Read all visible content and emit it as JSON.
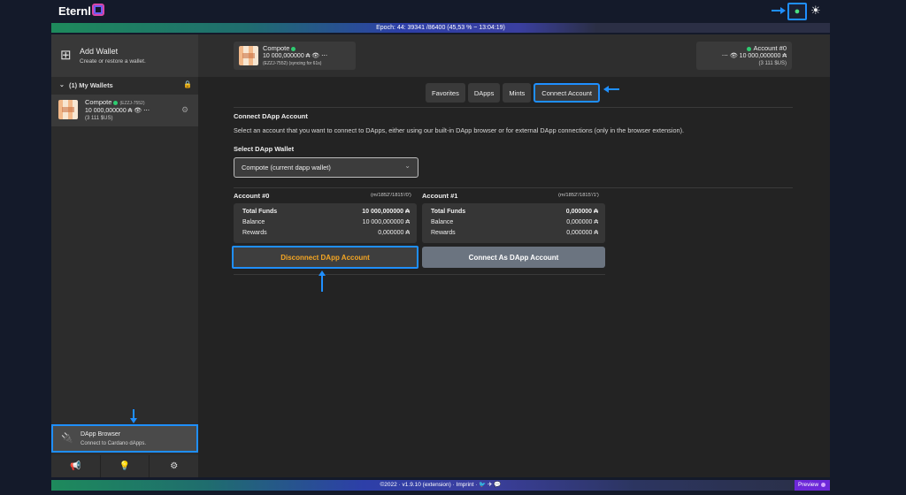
{
  "header": {
    "app_name": "Eternl",
    "dapp_toggle_icon": "plug-globe-icon",
    "theme_icon": "sun-icon"
  },
  "epoch": {
    "text": "Epoch: 44: 39341 /86400 (45,53 % ~ 13:04:19)"
  },
  "sidebar": {
    "add_wallet_title": "Add Wallet",
    "add_wallet_subtitle": "Create or restore a wallet.",
    "group_label": "(1) My Wallets",
    "wallet": {
      "name": "Compote",
      "tag": "(EZZJ-7552)",
      "balance": "10 000,000000 ₳",
      "usd": "(3 111 $US)"
    },
    "dapp_browser_title": "DApp Browser",
    "dapp_browser_subtitle": "Connect to Cardano dApps.",
    "bottom_icons": [
      "megaphone-icon",
      "lightbulb-icon",
      "gear-icon"
    ]
  },
  "walletbar": {
    "left_name": "Compote",
    "left_balance": "10 000,000000 ₳",
    "left_sync": "(EZZJ-7552) (syncing for 61s)",
    "right_name": "Account #0",
    "right_balance": "10 000,000000 ₳",
    "right_usd": "(3 111 $US)"
  },
  "tabs": [
    {
      "label": "Favorites",
      "active": false
    },
    {
      "label": "DApps",
      "active": false
    },
    {
      "label": "Mints",
      "active": false
    },
    {
      "label": "Connect Account",
      "active": true
    }
  ],
  "connect": {
    "title": "Connect DApp Account",
    "description": "Select an account that you want to connect to DApps, either using our built-in DApp browser or for external DApp connections (only in the browser extension).",
    "select_label": "Select DApp Wallet",
    "select_value": "Compote (current dapp wallet)"
  },
  "accounts": [
    {
      "name": "Account #0",
      "path": "(m/1852'/1815'/0')",
      "total_label": "Total Funds",
      "total": "10 000,000000 ₳",
      "balance_label": "Balance",
      "balance": "10 000,000000 ₳",
      "rewards_label": "Rewards",
      "rewards": "0,000000 ₳"
    },
    {
      "name": "Account #1",
      "path": "(m/1852'/1815'/1')",
      "total_label": "Total Funds",
      "total": "0,000000 ₳",
      "balance_label": "Balance",
      "balance": "0,000000 ₳",
      "rewards_label": "Rewards",
      "rewards": "0,000000 ₳"
    }
  ],
  "buttons": {
    "disconnect": "Disconnect DApp Account",
    "connect": "Connect As DApp Account"
  },
  "footer": {
    "text": "©2022 · v1.9.10 (extension) · Imprint · 🐦 ✈ 💬",
    "preview": "Preview"
  },
  "colors": {
    "accent_highlight": "#1f8fff",
    "disconnect_text": "#f5a623",
    "status_green": "#2ecc71"
  }
}
